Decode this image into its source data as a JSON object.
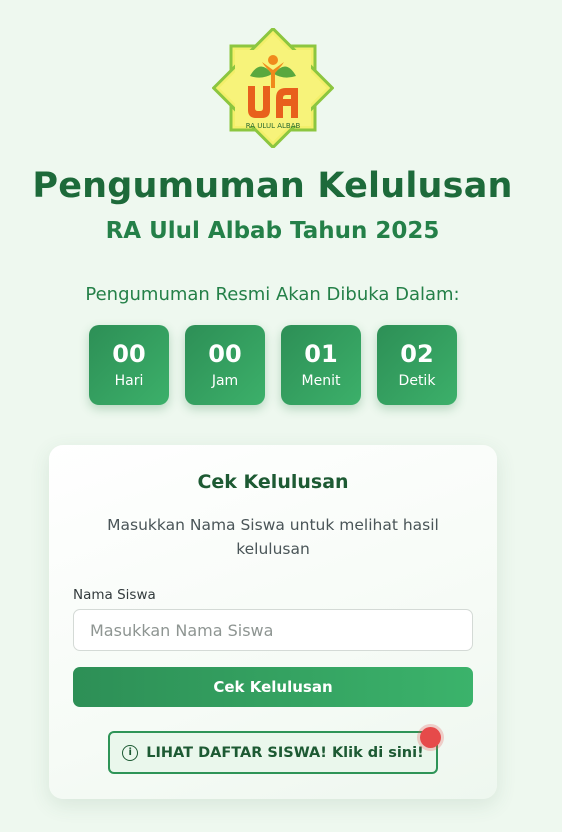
{
  "logo": {
    "name": "ra-ulul-albab-logo",
    "text": "RA ULUL ALBAB",
    "letters": "UA"
  },
  "header": {
    "title": "Pengumuman Kelulusan",
    "subtitle": "RA Ulul Albab Tahun 2025"
  },
  "countdown": {
    "label": "Pengumuman Resmi Akan Dibuka Dalam:",
    "units": [
      {
        "value": "00",
        "label": "Hari"
      },
      {
        "value": "00",
        "label": "Jam"
      },
      {
        "value": "01",
        "label": "Menit"
      },
      {
        "value": "02",
        "label": "Detik"
      }
    ]
  },
  "card": {
    "title": "Cek Kelulusan",
    "description": "Masukkan Nama Siswa untuk melihat hasil kelulusan",
    "field_label": "Nama Siswa",
    "field_placeholder": "Masukkan Nama Siswa",
    "field_value": "",
    "submit_label": "Cek Kelulusan",
    "list_button_label": "LIHAT DAFTAR SISWA! Klik di sini!",
    "list_button_icon": "info-icon"
  },
  "colors": {
    "background": "#eef8ef",
    "primary": "#2d8f56",
    "title": "#1d6a3a",
    "notification": "#e64a4a"
  }
}
